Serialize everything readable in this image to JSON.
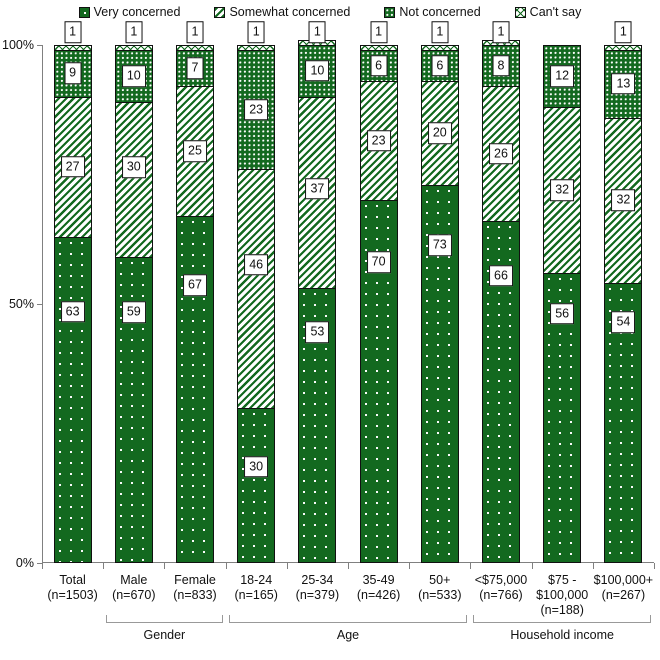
{
  "chart_data": {
    "type": "bar",
    "subtype": "stacked-bar-100-percent",
    "title": "",
    "xlabel": "",
    "ylabel": "",
    "ylim": [
      0,
      100
    ],
    "yticks": [
      0,
      50,
      100
    ],
    "ytick_labels": [
      "0%",
      "50%",
      "100%"
    ],
    "grid": false,
    "legend_position": "top",
    "stack_order_bottom_to_top": [
      "Very concerned",
      "Somewhat concerned",
      "Not concerned",
      "Can't say"
    ],
    "categories": [
      "Total",
      "Male",
      "Female",
      "18-24",
      "25-34",
      "35-49",
      "50+",
      "<$75,000",
      "$75 - $100,000",
      "$100,000+"
    ],
    "category_sample_sizes": [
      "(n=1503)",
      "(n=670)",
      "(n=833)",
      "(n=165)",
      "(n=379)",
      "(n=426)",
      "(n=533)",
      "(n=766)",
      "(n=188)",
      "(n=267)"
    ],
    "series": [
      {
        "name": "Very concerned",
        "values": [
          63,
          59,
          67,
          30,
          53,
          70,
          73,
          66,
          56,
          54
        ]
      },
      {
        "name": "Somewhat concerned",
        "values": [
          27,
          30,
          25,
          46,
          37,
          23,
          20,
          26,
          32,
          32
        ]
      },
      {
        "name": "Not concerned",
        "values": [
          9,
          10,
          7,
          23,
          10,
          6,
          6,
          8,
          12,
          13
        ]
      },
      {
        "name": "Can't say",
        "values": [
          1,
          1,
          1,
          1,
          1,
          1,
          1,
          1,
          null,
          1
        ]
      }
    ],
    "groups": [
      {
        "label": "Gender",
        "first_index": 1,
        "last_index": 2
      },
      {
        "label": "Age",
        "first_index": 3,
        "last_index": 6
      },
      {
        "label": "Household income",
        "first_index": 7,
        "last_index": 9
      }
    ],
    "colors": {
      "very_concerned": "#13691f",
      "somewhat_concerned": "#13691f",
      "not_concerned": "#13691f",
      "cant_say": "#13691f",
      "outline": "#111111",
      "axis": "#808080",
      "background": "#ffffff"
    }
  },
  "legend": {
    "items": [
      {
        "label": "Very concerned",
        "pattern": "solid-green-sparse-dots",
        "swatch_class": "pat-very"
      },
      {
        "label": "Somewhat concerned",
        "pattern": "green-diagonal-hatch",
        "swatch_class": "pat-somewhat"
      },
      {
        "label": "Not concerned",
        "pattern": "green-dense-dot-grid",
        "swatch_class": "pat-not"
      },
      {
        "label": "Can't say",
        "pattern": "green-cross-hatch",
        "swatch_class": "pat-cant"
      }
    ]
  }
}
